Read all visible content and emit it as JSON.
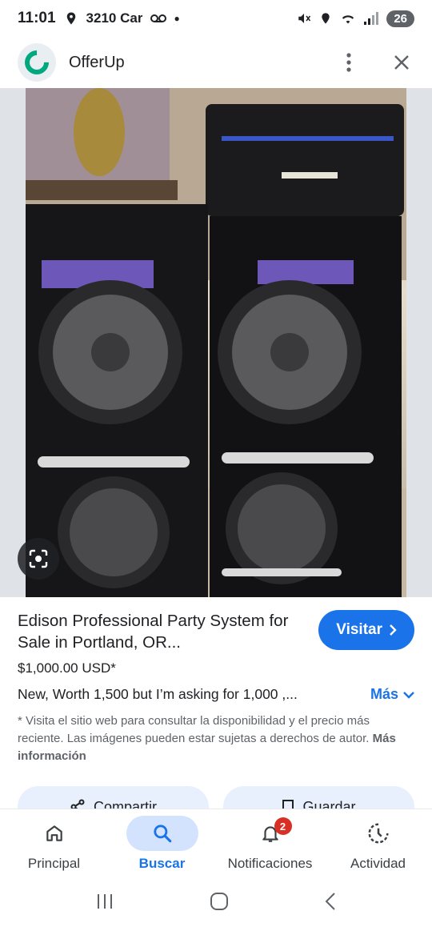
{
  "status": {
    "time": "11:01",
    "carrier": "3210 Car",
    "battery": "26"
  },
  "app": {
    "title": "OfferUp"
  },
  "listing": {
    "title": "Edison Professional Party System for Sale in Portland, OR...",
    "visit_label": "Visitar",
    "price": "$1,000.00 USD*",
    "description": "New, Worth 1,500 but I’m asking for 1,000 ,...",
    "more_label": "Más",
    "disclaimer": "* Visita el sitio web para consultar la disponibilidad y el precio más reciente. Las imágenes pueden estar sujetas a derechos de autor.",
    "more_info_label": "Más información"
  },
  "actions": {
    "share_label": "Compartir",
    "save_label": "Guardar"
  },
  "bottom_nav": {
    "items": [
      {
        "label": "Principal"
      },
      {
        "label": "Buscar"
      },
      {
        "label": "Notificaciones",
        "badge": "2"
      },
      {
        "label": "Actividad"
      }
    ]
  },
  "colors": {
    "accent": "#1a73e8",
    "brand_green": "#00a87e",
    "badge_red": "#d93025"
  }
}
